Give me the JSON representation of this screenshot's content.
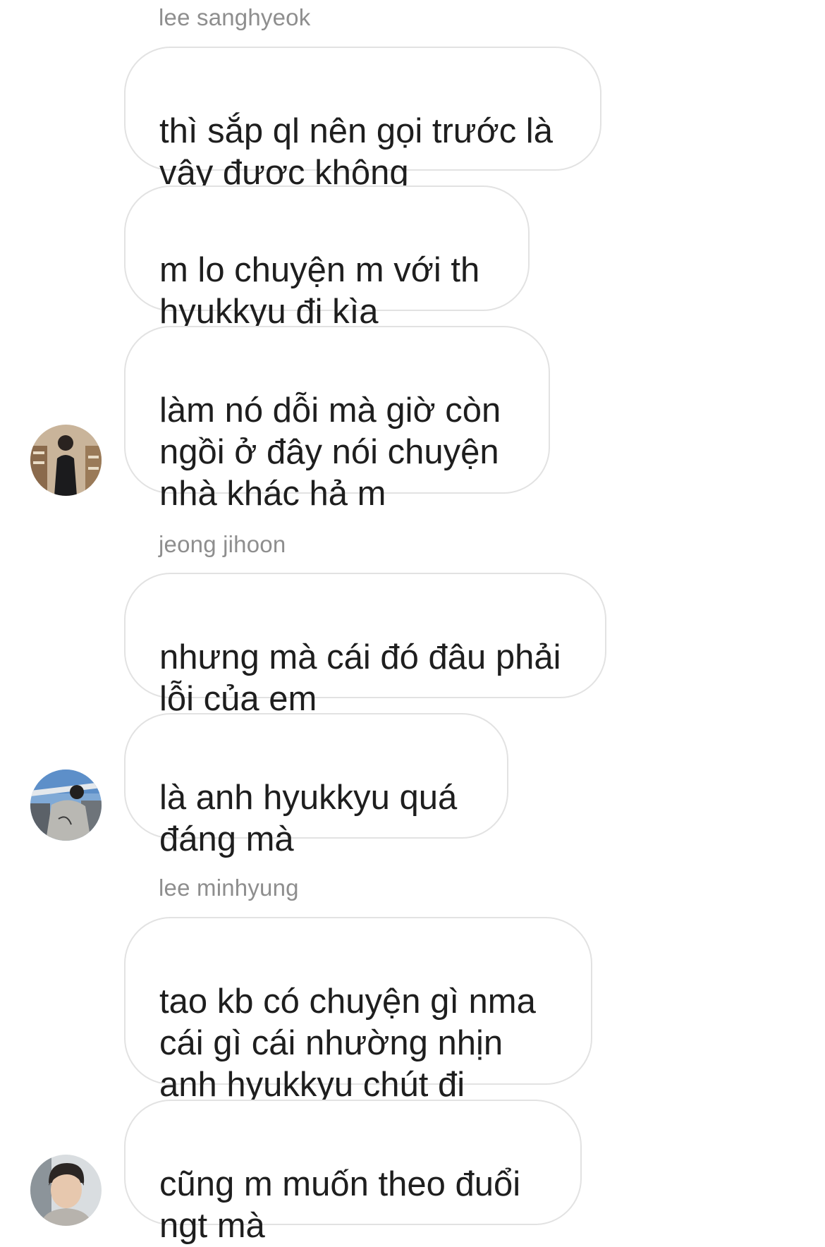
{
  "conversation": {
    "groups": [
      {
        "sender": "lee sanghyeok",
        "avatar_icon": "user-avatar-photo",
        "messages": [
          "thì sắp ql nên gọi trước là vậy được không",
          "m lo chuyện m với th hyukkyu đi kìa",
          "làm nó dỗi mà giờ còn ngồi ở đây nói chuyện nhà khác hả m"
        ]
      },
      {
        "sender": "jeong jihoon",
        "avatar_icon": "user-avatar-photo",
        "messages": [
          "nhưng mà cái đó đâu phải lỗi của em",
          "là anh hyukkyu quá đáng mà"
        ]
      },
      {
        "sender": "lee minhyung",
        "avatar_icon": "user-avatar-photo",
        "messages": [
          "tao kb có chuyện gì nma cái gì cái nhường nhịn anh hyukkyu chút đi",
          "cũng m muốn theo đuổi ngt mà"
        ]
      }
    ]
  },
  "colors": {
    "bubble_border": "#e2e2e2",
    "sender_name": "#8e8e8e",
    "message_text": "#1e1e1e",
    "background": "#ffffff"
  }
}
